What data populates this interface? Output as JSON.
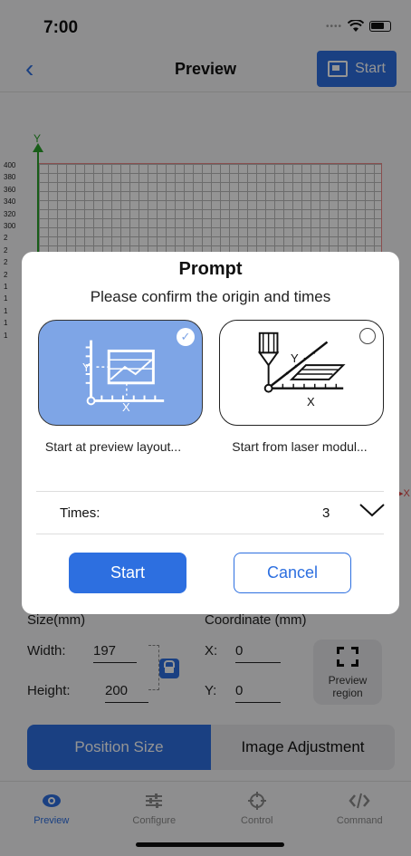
{
  "status_bar": {
    "time": "7:00"
  },
  "nav": {
    "back_icon": "chevron-left-icon",
    "title": "Preview",
    "start_label": "Start",
    "start_icon": "device-icon"
  },
  "canvas": {
    "y_axis": "Y",
    "x_axis": "X",
    "y_ticks": [
      "400",
      "380",
      "360",
      "340",
      "320",
      "300",
      "2",
      "2",
      "2",
      "2",
      "1",
      "1",
      "1",
      "1",
      "1"
    ]
  },
  "properties": {
    "size_label": "Size(mm)",
    "width_label": "Width:",
    "width_value": "197",
    "height_label": "Height:",
    "height_value": "200",
    "coordinate_label": "Coordinate (mm)",
    "x_label": "X:",
    "x_value": "0",
    "y_label": "Y:",
    "y_value": "0",
    "preview_region_label": "Preview region"
  },
  "bottom_tabs": {
    "position_size": "Position Size",
    "image_adjustment": "Image Adjustment"
  },
  "tabbar": [
    {
      "label": "Preview",
      "icon": "eye-icon",
      "active": true
    },
    {
      "label": "Configure",
      "icon": "sliders-icon",
      "active": false
    },
    {
      "label": "Control",
      "icon": "crosshair-icon",
      "active": false
    },
    {
      "label": "Command",
      "icon": "code-icon",
      "active": false
    }
  ],
  "modal": {
    "title": "Prompt",
    "subtitle": "Please confirm the origin and times",
    "option_preview": {
      "label": "Start at preview layout...",
      "selected": true,
      "x": "X",
      "y": "Y"
    },
    "option_laser": {
      "label": "Start from laser modul...",
      "selected": false,
      "x": "X",
      "y": "Y"
    },
    "times_label": "Times:",
    "times_value": "3",
    "start_label": "Start",
    "cancel_label": "Cancel"
  },
  "colors": {
    "accent": "#2d6fe0",
    "selected_card": "#7ea5e6",
    "axis_green": "#2aa02a"
  }
}
